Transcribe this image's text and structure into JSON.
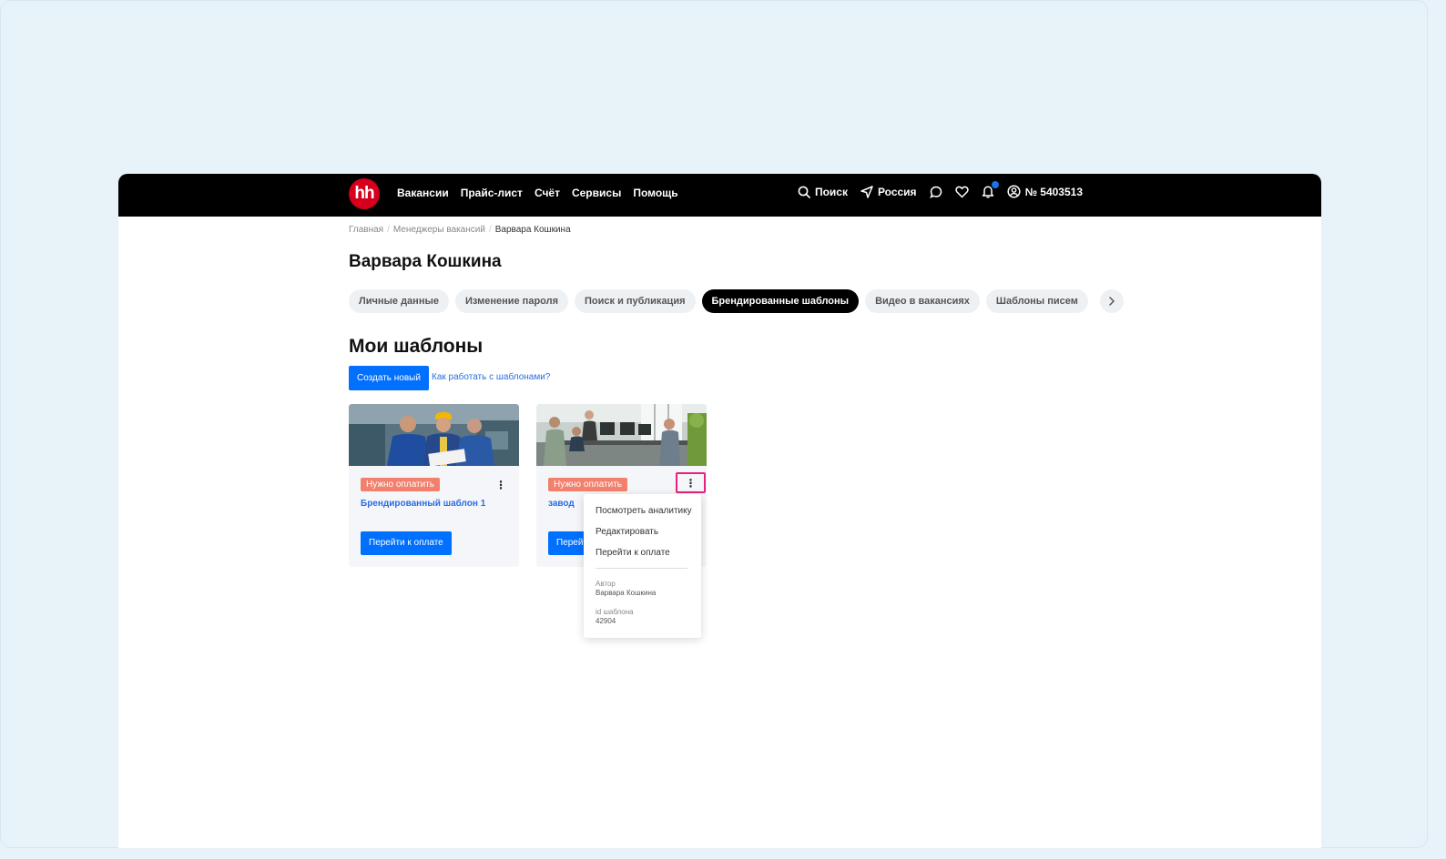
{
  "topbar": {
    "logo_text": "hh",
    "nav": [
      "Вакансии",
      "Прайс-лист",
      "Счёт",
      "Сервисы",
      "Помощь"
    ],
    "search_label": "Поиск",
    "region_label": "Россия",
    "account_label": "№ 5403513"
  },
  "breadcrumb": {
    "items": [
      "Главная",
      "Менеджеры вакансий"
    ],
    "current": "Варвара Кошкина"
  },
  "page_title": "Варвара Кошкина",
  "tabs": [
    "Личные данные",
    "Изменение пароля",
    "Поиск и публикация",
    "Брендированные шаблоны",
    "Видео в вакансиях",
    "Шаблоны писем"
  ],
  "active_tab": "Брендированные шаблоны",
  "section": {
    "title": "Мои шаблоны",
    "create_label": "Создать новый",
    "help_link": "Как работать с шаблонами?"
  },
  "cards": [
    {
      "badge": "Нужно оплатить",
      "name": "Брендированный шаблон 1",
      "pay_label": "Перейти к оплате"
    },
    {
      "badge": "Нужно оплатить",
      "name": "завод",
      "pay_label": "Перейти к оплате"
    }
  ],
  "menu": {
    "items": [
      "Посмотреть аналитику",
      "Редактировать",
      "Перейти к оплате"
    ],
    "author_label": "Автор",
    "author_value": "Варвара Кошкина",
    "id_label": "id шаблона",
    "id_value": "42904"
  },
  "colors": {
    "accent": "#0070ff",
    "badge": "#f2806d",
    "logo": "#d6001c",
    "highlight": "#e4237e"
  }
}
